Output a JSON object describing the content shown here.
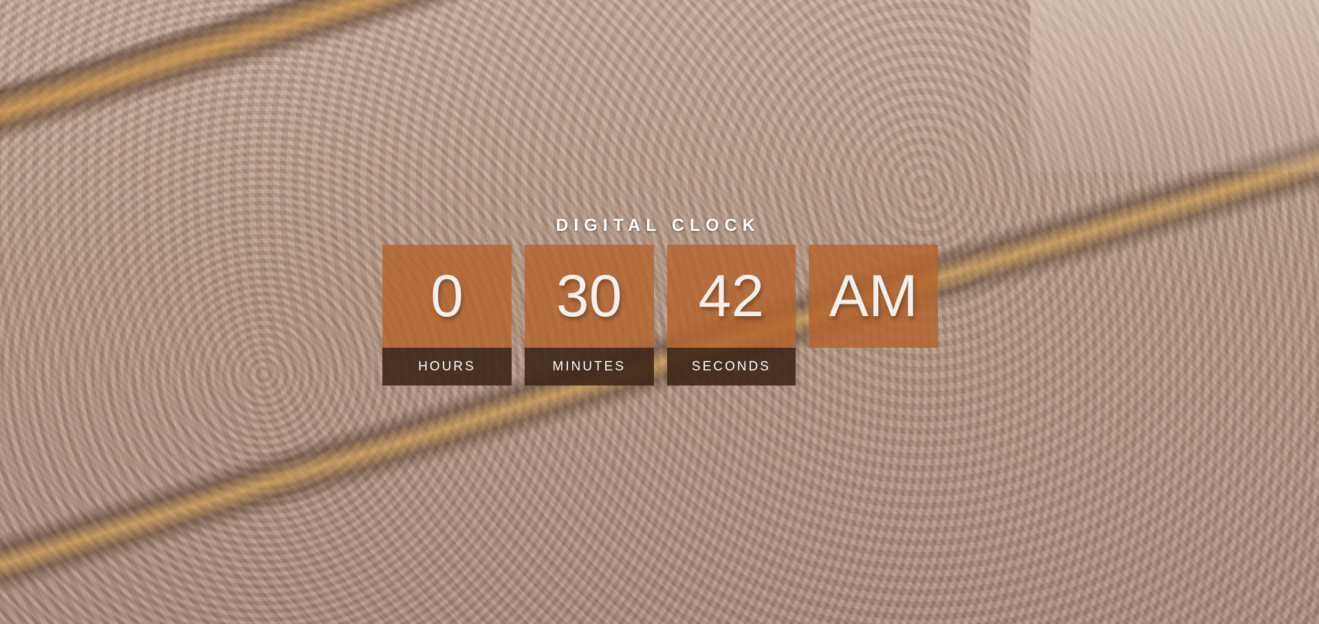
{
  "clock": {
    "title": "DIGITAL CLOCK",
    "hours": {
      "value": "0",
      "label": "HOURS"
    },
    "minutes": {
      "value": "30",
      "label": "MINUTES"
    },
    "seconds": {
      "value": "42",
      "label": "SECONDS"
    },
    "period": {
      "value": "AM"
    }
  },
  "colors": {
    "value_box": "#b4642d",
    "label_box": "#3e2616",
    "text": "#ffffff"
  }
}
